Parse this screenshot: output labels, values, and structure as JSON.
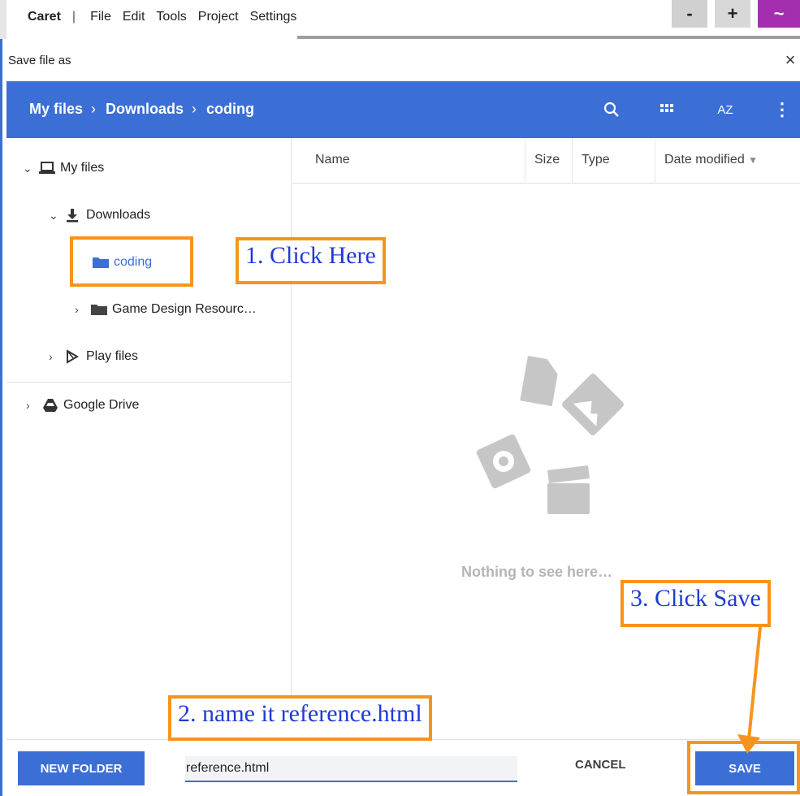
{
  "app": {
    "brand": "Caret",
    "menu": [
      "File",
      "Edit",
      "Tools",
      "Project",
      "Settings"
    ],
    "window_buttons": {
      "minimize": "-",
      "maximize": "+",
      "menu": "~"
    }
  },
  "dialog": {
    "title": "Save file as",
    "close": "×",
    "breadcrumb": [
      "My files",
      "Downloads",
      "coding"
    ],
    "breadcrumb_sep": "›",
    "toolbar": {
      "sort_label": "AZ"
    }
  },
  "sidebar": {
    "my_files": "My files",
    "downloads": "Downloads",
    "coding": "coding",
    "game_design": "Game Design Resourc…",
    "play_files": "Play files",
    "google_drive": "Google Drive"
  },
  "list": {
    "columns": {
      "name": "Name",
      "size": "Size",
      "type": "Type",
      "date": "Date modified"
    },
    "empty_message": "Nothing to see here…"
  },
  "footer": {
    "new_folder": "NEW FOLDER",
    "filename_value": "reference.html",
    "cancel": "CANCEL",
    "save": "SAVE"
  },
  "annotations": {
    "step1": "1. Click Here",
    "step2": "2. name it reference.html",
    "step3": "3. Click Save"
  },
  "colors": {
    "accent": "#3c6fd6",
    "annotation": "#f7941d",
    "annotation_text": "#1f3ad6"
  }
}
